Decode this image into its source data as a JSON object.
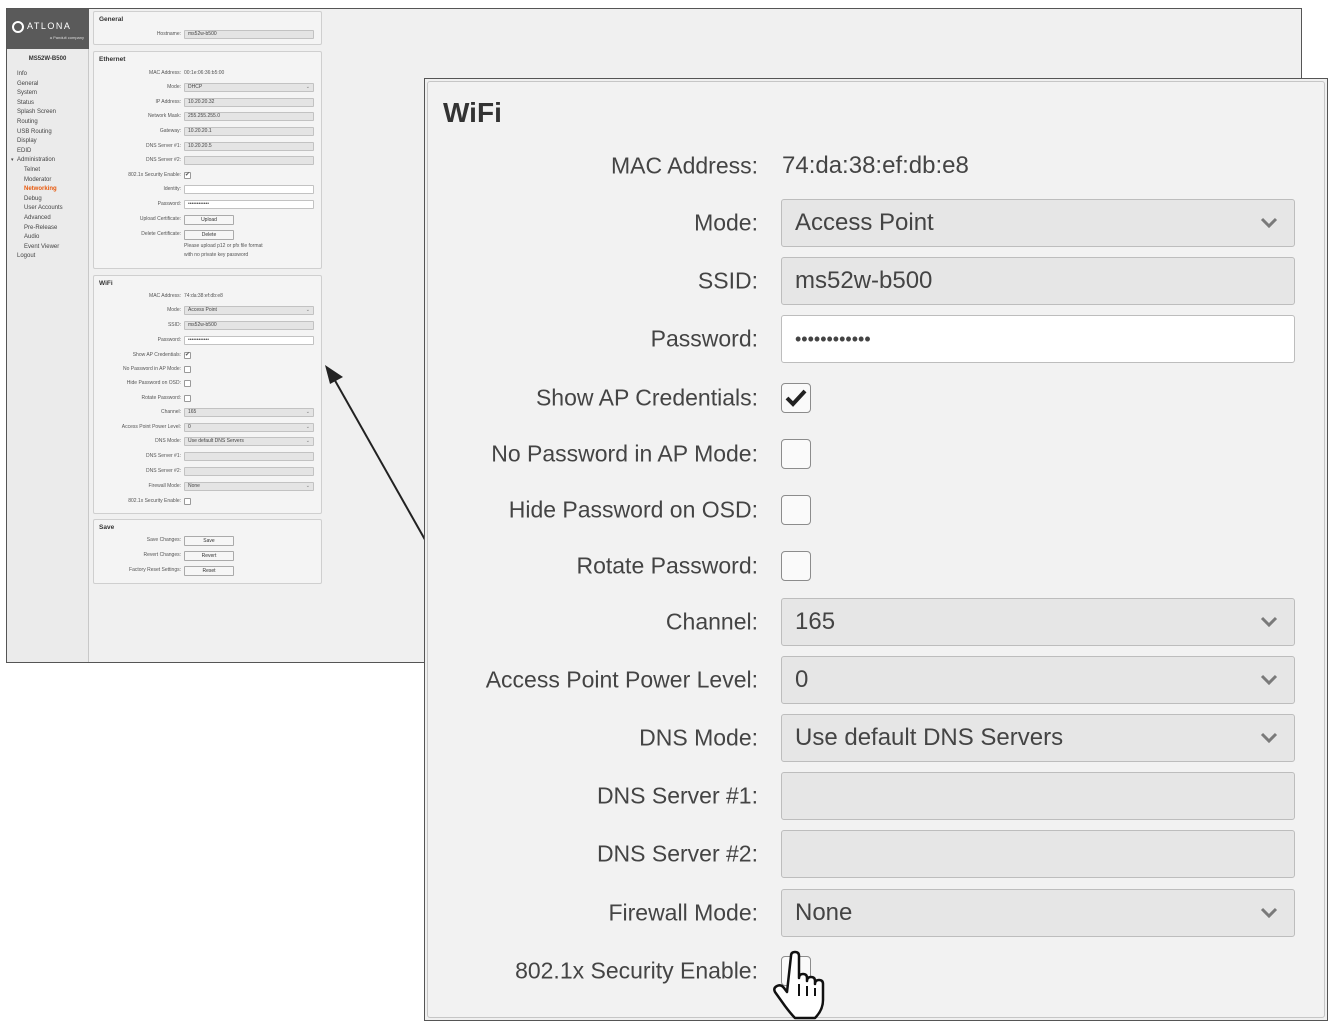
{
  "brand": {
    "logo_text": "ATLONA",
    "logo_sub": "a Panduit company"
  },
  "sidebar": {
    "device_name": "MS52W-B500",
    "items": [
      {
        "label": "Info",
        "level": 0
      },
      {
        "label": "General",
        "level": 0
      },
      {
        "label": "System",
        "level": 0
      },
      {
        "label": "Status",
        "level": 0
      },
      {
        "label": "Splash Screen",
        "level": 0
      },
      {
        "label": "Routing",
        "level": 0
      },
      {
        "label": "USB Routing",
        "level": 0
      },
      {
        "label": "Display",
        "level": 0
      },
      {
        "label": "EDID",
        "level": 0
      },
      {
        "label": "Administration",
        "level": 0,
        "group": true
      },
      {
        "label": "Telnet",
        "level": 1
      },
      {
        "label": "Moderator",
        "level": 1
      },
      {
        "label": "Networking",
        "level": 1,
        "active": true
      },
      {
        "label": "Debug",
        "level": 1
      },
      {
        "label": "User Accounts",
        "level": 1
      },
      {
        "label": "Advanced",
        "level": 1
      },
      {
        "label": "Pre-Release",
        "level": 1
      },
      {
        "label": "Audio",
        "level": 1
      },
      {
        "label": "Event Viewer",
        "level": 1
      },
      {
        "label": "Logout",
        "level": 0
      }
    ]
  },
  "general": {
    "title": "General",
    "hostname_label": "Hostname:",
    "hostname": "ms52w-b500"
  },
  "ethernet": {
    "title": "Ethernet",
    "mac_label": "MAC Address:",
    "mac": "00:1e:06:36:b5:00",
    "mode_label": "Mode:",
    "mode": "DHCP",
    "ip_label": "IP Address:",
    "ip": "10.20.20.32",
    "mask_label": "Network Mask:",
    "mask": "255.255.255.0",
    "gateway_label": "Gateway:",
    "gateway": "10.20.20.1",
    "dns1_label": "DNS Server #1:",
    "dns1": "10.20.20.5",
    "dns2_label": "DNS Server #2:",
    "dns2": "",
    "security_label": "802.1x Security Enable:",
    "security_checked": true,
    "identity_label": "Identity:",
    "identity": "",
    "password_label": "Password:",
    "password": "••••••••••••",
    "upload_label": "Upload Certificate:",
    "upload_btn": "Upload",
    "delete_label": "Delete Certificate:",
    "delete_btn": "Delete",
    "note_1": "Please upload p12 or pfx file format",
    "note_2": "with no private key password"
  },
  "wifi": {
    "title": "WiFi",
    "mac_label": "MAC Address:",
    "mac": "74:da:38:ef:db:e8",
    "mode_label": "Mode:",
    "mode": "Access Point",
    "ssid_label": "SSID:",
    "ssid": "ms52w-b500",
    "password_label": "Password:",
    "password": "••••••••••••",
    "show_ap_label": "Show AP Credentials:",
    "show_ap_checked": true,
    "no_pw_label": "No Password in AP Mode:",
    "no_pw_checked": false,
    "hide_pw_label": "Hide Password on OSD:",
    "hide_pw_checked": false,
    "rotate_label": "Rotate Password:",
    "rotate_checked": false,
    "channel_label": "Channel:",
    "channel": "165",
    "power_label": "Access Point Power Level:",
    "power": "0",
    "dns_mode_label": "DNS Mode:",
    "dns_mode": "Use default DNS Servers",
    "dns1_label": "DNS Server #1:",
    "dns1": "",
    "dns2_label": "DNS Server #2:",
    "dns2": "",
    "firewall_label": "Firewall Mode:",
    "firewall": "None",
    "security_label": "802.1x Security Enable:",
    "security_checked": false
  },
  "save": {
    "title": "Save",
    "save_label": "Save Changes:",
    "save_btn": "Save",
    "revert_label": "Revert Changes:",
    "revert_btn": "Revert",
    "reset_label": "Factory Reset Settings:",
    "reset_btn": "Reset"
  },
  "icons": {
    "chevron": "chevron-down-icon",
    "check": "checkmark-icon",
    "cursor": "hand-pointer-icon",
    "logo": "atlona-logo-icon"
  },
  "colors": {
    "active_nav": "#e8590c",
    "sidebar_bg": "#ebebeb",
    "logo_bg": "#5a5a5a",
    "field_bg": "#e6e6e6"
  }
}
